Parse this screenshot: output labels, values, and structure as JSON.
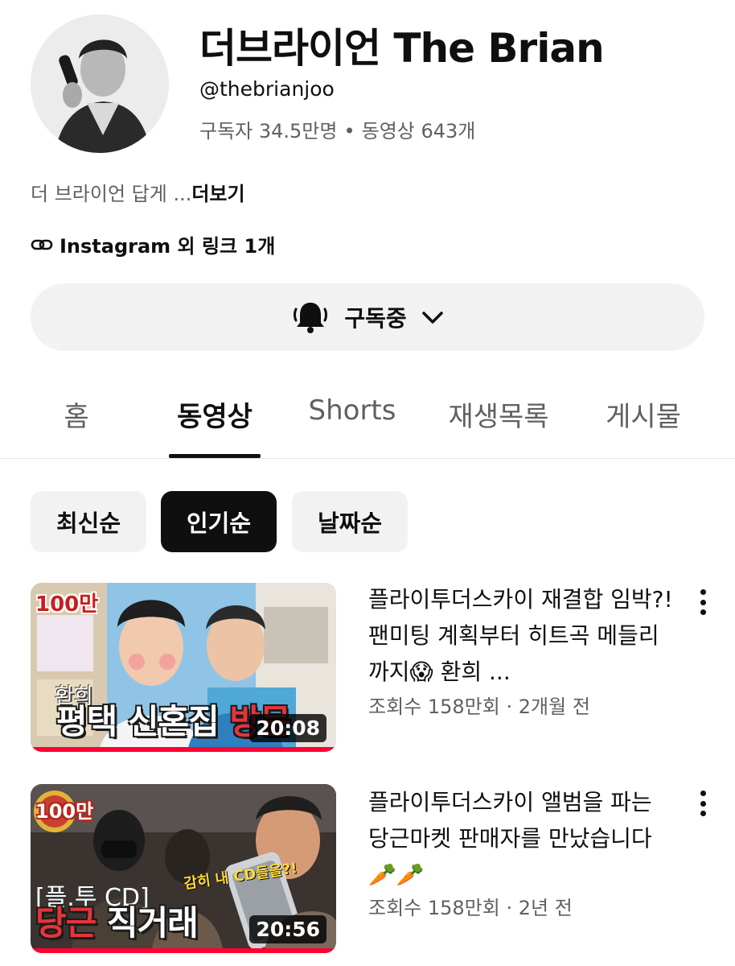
{
  "channel": {
    "name": "더브라이언 The Brian",
    "handle": "@thebrianjoo",
    "subscribers": "구독자 34.5만명",
    "separator": "•",
    "video_count": "동영상 643개",
    "description": "더 브라이언 답게 ...",
    "more_label": "더보기",
    "links_text": "Instagram 외 링크 1개"
  },
  "subscribe_button": {
    "label": "구독중",
    "icon": "bell-icon"
  },
  "tabs": [
    {
      "label": "홈",
      "active": false
    },
    {
      "label": "동영상",
      "active": true
    },
    {
      "label": "Shorts",
      "active": false
    },
    {
      "label": "재생목록",
      "active": false
    },
    {
      "label": "게시물",
      "active": false
    }
  ],
  "sort_chips": [
    {
      "label": "최신순",
      "active": false
    },
    {
      "label": "인기순",
      "active": true
    },
    {
      "label": "날짜순",
      "active": false
    }
  ],
  "videos": [
    {
      "title": "플라이투더스카이 재결합 임박?! 팬미팅 계획부터 히트곡 메들리까지😱 환희 ...",
      "views": "조회수 158만회",
      "meta_separator": "·",
      "age": "2개월 전",
      "duration": "20:08",
      "progress_fraction": 1.0,
      "thumbnail": {
        "badge": "100만",
        "tag": "환희",
        "title_part1": "평택 신혼집 ",
        "title_part2": "방문"
      }
    },
    {
      "title": "플라이투더스카이 앨범을 파는 당근마켓 판매자를 만났습니다 🥕🥕",
      "views": "조회수 158만회",
      "meta_separator": "·",
      "age": "2년 전",
      "duration": "20:56",
      "progress_fraction": 1.0,
      "thumbnail": {
        "badge": "100만",
        "tag": "[플.투 CD]",
        "caption": "감히 내 CD들을?!",
        "title_part1": "당근",
        "title_part2": " 직거래"
      }
    }
  ],
  "colors": {
    "accent_red": "#ff0033",
    "chip_active_bg": "#0f0f0f",
    "chip_bg": "#f2f2f2",
    "secondary_text": "#606060"
  }
}
